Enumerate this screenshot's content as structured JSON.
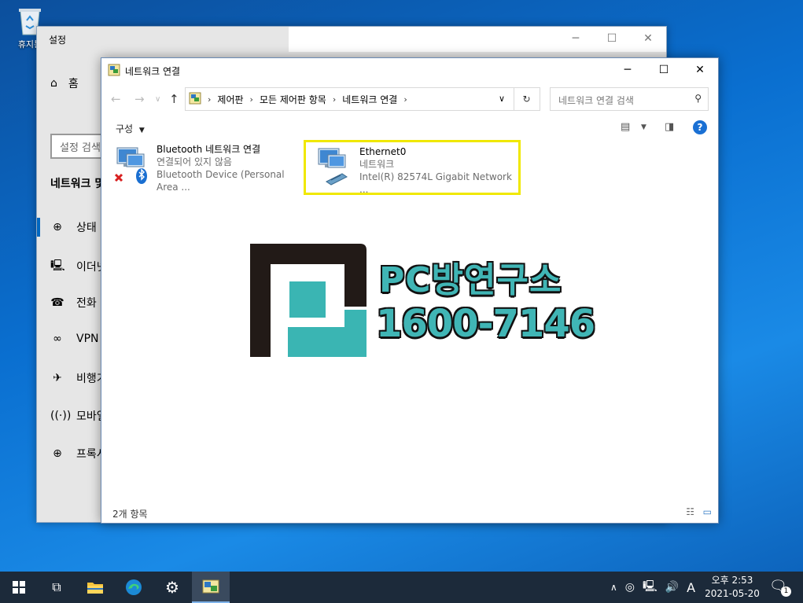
{
  "desktop": {
    "recycle_bin_label": "휴지통"
  },
  "settings_window": {
    "title": "설정",
    "home_label": "홈",
    "search_placeholder": "설정 검색",
    "section_title": "네트워크 및 인터넷",
    "nav_items": [
      {
        "label": "상태",
        "icon": "globe-status-icon"
      },
      {
        "label": "이더넷",
        "icon": "ethernet-icon"
      },
      {
        "label": "전화 접속",
        "icon": "dialup-icon"
      },
      {
        "label": "VPN",
        "icon": "vpn-icon"
      },
      {
        "label": "비행기 모드",
        "icon": "airplane-icon"
      },
      {
        "label": "모바일 핫스팟",
        "icon": "hotspot-icon"
      },
      {
        "label": "프록시",
        "icon": "proxy-globe-icon"
      }
    ]
  },
  "explorer_window": {
    "title": "네트워크 연결",
    "breadcrumb": [
      "제어판",
      "모든 제어판 항목",
      "네트워크 연결"
    ],
    "search_placeholder": "네트워크 연결 검색",
    "organize_label": "구성",
    "items": [
      {
        "name": "Bluetooth 네트워크 연결",
        "status": "연결되어 있지 않음",
        "device": "Bluetooth Device (Personal Area ..."
      },
      {
        "name": "Ethernet0",
        "status": "네트워크",
        "device": "Intel(R) 82574L Gigabit Network ..."
      }
    ],
    "status_bar": "2개 항목"
  },
  "watermark": {
    "brand": "PC방연구소",
    "phone": "1600-7146"
  },
  "taskbar": {
    "clock_time": "오후 2:53",
    "clock_date": "2021-05-20",
    "ime_label": "A",
    "notification_count": "1"
  }
}
